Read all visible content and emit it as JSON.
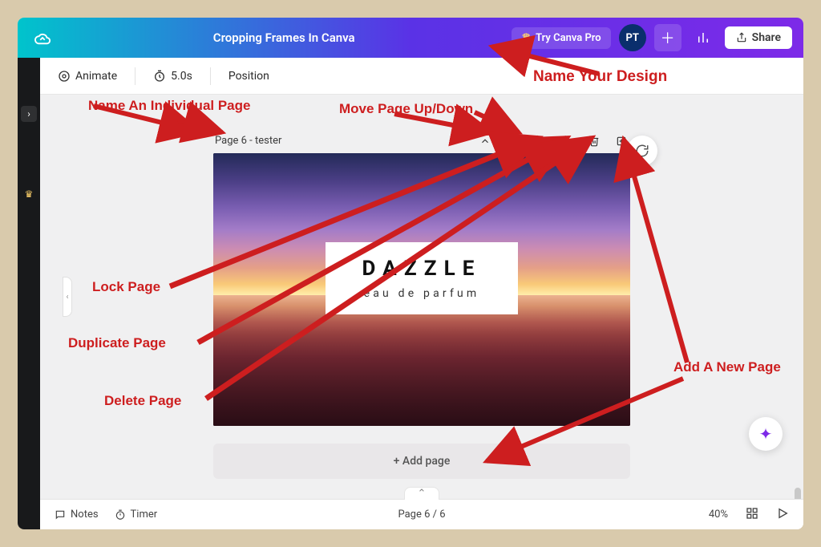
{
  "header": {
    "title": "Cropping Frames In Canva",
    "try_pro_label": "Try Canva Pro",
    "avatar_initials": "PT",
    "share_label": "Share"
  },
  "toolbar": {
    "animate_label": "Animate",
    "duration_label": "5.0s",
    "position_label": "Position"
  },
  "page": {
    "label": "Page 6 - tester",
    "dazzle_title": "DAZZLE",
    "dazzle_sub": "eau de parfum"
  },
  "add_page_label": "+ Add page",
  "footer": {
    "notes_label": "Notes",
    "timer_label": "Timer",
    "page_indicator": "Page 6 / 6",
    "zoom_label": "40%"
  },
  "annotations": {
    "name_design": "Name Your Design",
    "name_individual": "Name An Individual Page",
    "move_page": "Move Page Up/Down",
    "lock_page": "Lock Page",
    "duplicate_page": "Duplicate Page",
    "delete_page": "Delete Page",
    "add_new_page": "Add A New Page"
  }
}
